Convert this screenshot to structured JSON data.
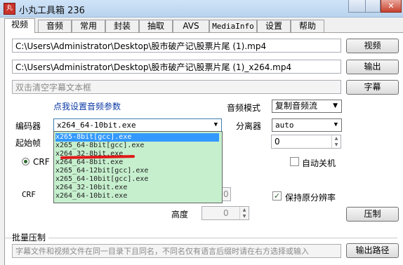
{
  "window": {
    "title": "小丸工具箱 236",
    "icon_glyph": "丸"
  },
  "tabs": [
    "视频",
    "音频",
    "常用",
    "封装",
    "抽取",
    "AVS",
    "MediaInfo",
    "设置",
    "帮助"
  ],
  "video": {
    "video_path": "C:\\Users\\Administrator\\Desktop\\股市破产记\\股票片尾 (1).mp4",
    "video_button": "视频",
    "output_path": "C:\\Users\\Administrator\\Desktop\\股市破产记\\股票片尾 (1)_x264.mp4",
    "output_button": "输出",
    "subtitle_placeholder": "双击清空字幕文本框",
    "subtitle_button": "字幕",
    "audio_params_link": "点我设置音频参数",
    "audio_mode_label": "音频模式",
    "audio_mode_value": "复制音频流",
    "encoder_label": "编码器",
    "encoder_value": "x264_64-10bit.exe",
    "demuxer_label": "分离器",
    "demuxer_value": "auto",
    "start_frame_label": "起始帧",
    "start_frame_value": "0",
    "crf_radio_label": "CRF",
    "crf_label": "CRF",
    "crf_spin_value": "0",
    "auto_shutdown_label": "自动关机",
    "width_spin_value": "0",
    "keep_resolution_label": "保持原分辨率",
    "height_label": "高度",
    "height_value": "0",
    "encode_button": "压制",
    "batch_label": "批量压制",
    "batch_placeholder": "字幕文件和视频文件在同一目录下且同名，不同名仅有语言后缀时请在右方选择或输入",
    "batch_output_button": "输出路径"
  },
  "encoder_options": [
    "x265-8bit[gcc].exe",
    "x265_64-8bit[gcc].exe",
    "x264_32-8bit.exe",
    "x264_64-8bit.exe",
    "x265_64-12bit[gcc].exe",
    "x265_64-10bit[gcc].exe",
    "x264_32-10bit.exe",
    "x264_64-10bit.exe"
  ],
  "colors": {
    "dropdown_bg": "#c6efce",
    "selection": "#3399ff",
    "annotation_mark": "#e01818",
    "link": "#0b3aa5"
  }
}
